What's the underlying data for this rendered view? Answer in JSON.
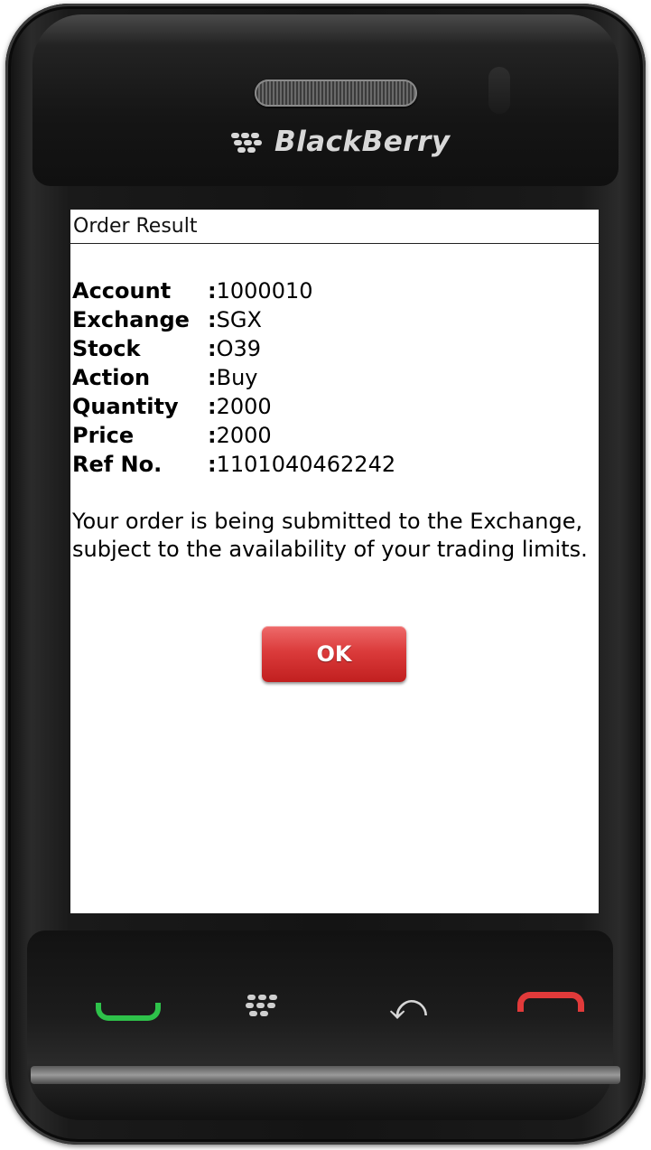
{
  "device": {
    "brand": "BlackBerry"
  },
  "screen": {
    "title": "Order Result",
    "fields": [
      {
        "label": "Account",
        "value": "1000010"
      },
      {
        "label": "Exchange",
        "value": "SGX"
      },
      {
        "label": "Stock",
        "value": "O39"
      },
      {
        "label": "Action",
        "value": "Buy"
      },
      {
        "label": "Quantity",
        "value": "2000"
      },
      {
        "label": "Price",
        "value": "2000"
      },
      {
        "label": "Ref No.",
        "value": "1101040462242"
      }
    ],
    "separator": ":",
    "message": "Your order is being submitted to the Exchange, subject to the availability of your trading limits.",
    "ok_label": "OK"
  },
  "keys": {
    "call": "call-icon",
    "menu": "blackberry-menu-icon",
    "back": "back-icon",
    "end": "end-call-icon"
  },
  "colors": {
    "ok_button": "#d83333",
    "call_key": "#2ec24a",
    "end_key": "#e13a3a"
  }
}
